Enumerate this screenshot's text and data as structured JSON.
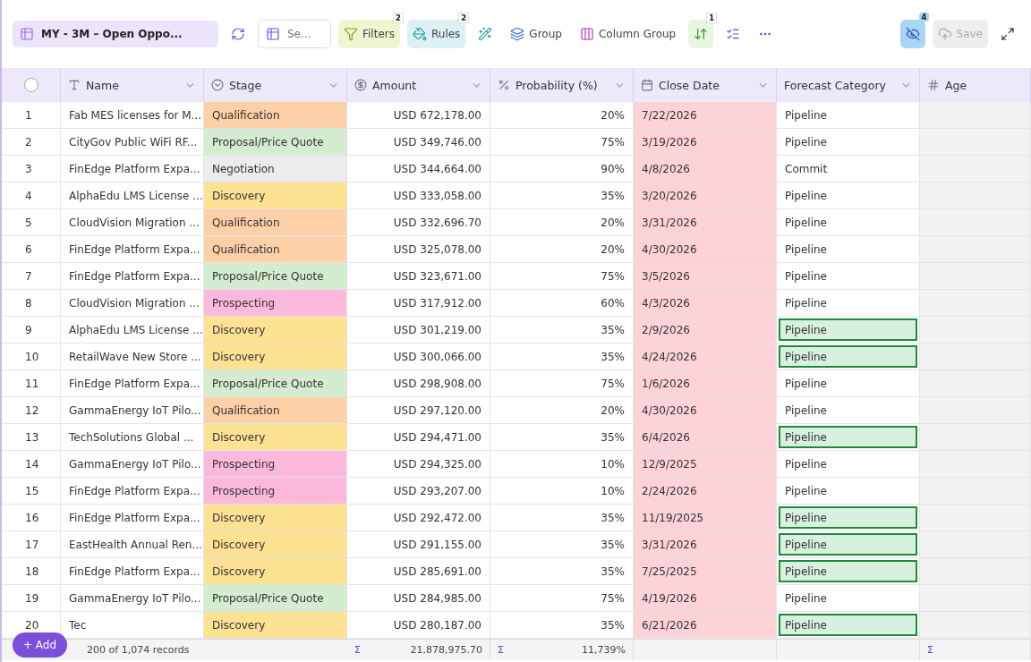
{
  "toolbar": {
    "view": "MY - 3M – Open Oppo...",
    "search": {
      "placeholder": "Se..."
    },
    "filters": {
      "label": "Filters",
      "badge": "2"
    },
    "rules": {
      "label": "Rules",
      "badge": "2"
    },
    "group": {
      "label": "Group"
    },
    "column_group": {
      "label": "Column Group"
    },
    "sort": {
      "badge": "1"
    },
    "hidden_fields": {
      "badge": "4"
    },
    "save": {
      "label": "Save",
      "disabled": true
    }
  },
  "table": {
    "select_all": {
      "checked": false
    },
    "columns": [
      {
        "label": "Name"
      },
      {
        "label": "Stage"
      },
      {
        "label": "Amount"
      },
      {
        "label": "Probability (%)"
      },
      {
        "label": "Close Date"
      },
      {
        "label": "Forecast Category"
      },
      {
        "label": "Age"
      }
    ],
    "rows": [
      {
        "n": "1",
        "name": "Fab MES licenses for M...",
        "stage": "Qualification",
        "color": "#fdd0a8",
        "amount": "USD 672,178.00",
        "prob": "20%",
        "date": "7/22/2026",
        "forecast": "Pipeline",
        "highlighted": false
      },
      {
        "n": "2",
        "name": "CityGov Public WiFi RF...",
        "stage": "Proposal/Price Quote",
        "color": "#d4ecd0",
        "amount": "USD 349,746.00",
        "prob": "75%",
        "date": "3/19/2026",
        "forecast": "Pipeline",
        "highlighted": false
      },
      {
        "n": "3",
        "name": "FinEdge Platform Expa...",
        "stage": "Negotiation",
        "color": "#ececee",
        "amount": "USD 344,664.00",
        "prob": "90%",
        "date": "4/8/2026",
        "forecast": "Commit",
        "highlighted": false
      },
      {
        "n": "4",
        "name": "AlphaEdu LMS License ...",
        "stage": "Discovery",
        "color": "#fde293",
        "amount": "USD 333,058.00",
        "prob": "35%",
        "date": "3/20/2026",
        "forecast": "Pipeline",
        "highlighted": false
      },
      {
        "n": "5",
        "name": "CloudVision Migration ...",
        "stage": "Qualification",
        "color": "#fdd0a8",
        "amount": "USD 332,696.70",
        "prob": "20%",
        "date": "3/31/2026",
        "forecast": "Pipeline",
        "highlighted": false
      },
      {
        "n": "6",
        "name": "FinEdge Platform Expa...",
        "stage": "Qualification",
        "color": "#fdd0a8",
        "amount": "USD 325,078.00",
        "prob": "20%",
        "date": "4/30/2026",
        "forecast": "Pipeline",
        "highlighted": false
      },
      {
        "n": "7",
        "name": "FinEdge Platform Expa...",
        "stage": "Proposal/Price Quote",
        "color": "#d4ecd0",
        "amount": "USD 323,671.00",
        "prob": "75%",
        "date": "3/5/2026",
        "forecast": "Pipeline",
        "highlighted": false
      },
      {
        "n": "8",
        "name": "CloudVision Migration ...",
        "stage": "Prospecting",
        "color": "#fcb9dc",
        "amount": "USD 317,912.00",
        "prob": "60%",
        "date": "4/3/2026",
        "forecast": "Pipeline",
        "highlighted": false
      },
      {
        "n": "9",
        "name": "AlphaEdu LMS License ...",
        "stage": "Discovery",
        "color": "#fde293",
        "amount": "USD 301,219.00",
        "prob": "35%",
        "date": "2/9/2026",
        "forecast": "Pipeline",
        "highlighted": true
      },
      {
        "n": "10",
        "name": "RetailWave New Store ...",
        "stage": "Discovery",
        "color": "#fde293",
        "amount": "USD 300,066.00",
        "prob": "35%",
        "date": "4/24/2026",
        "forecast": "Pipeline",
        "highlighted": true
      },
      {
        "n": "11",
        "name": "FinEdge Platform Expa...",
        "stage": "Proposal/Price Quote",
        "color": "#d4ecd0",
        "amount": "USD 298,908.00",
        "prob": "75%",
        "date": "1/6/2026",
        "forecast": "Pipeline",
        "highlighted": false
      },
      {
        "n": "12",
        "name": "GammaEnergy IoT Pilo...",
        "stage": "Qualification",
        "color": "#fdd0a8",
        "amount": "USD 297,120.00",
        "prob": "20%",
        "date": "4/30/2026",
        "forecast": "Pipeline",
        "highlighted": false
      },
      {
        "n": "13",
        "name": "TechSolutions Global ...",
        "stage": "Discovery",
        "color": "#fde293",
        "amount": "USD 294,471.00",
        "prob": "35%",
        "date": "6/4/2026",
        "forecast": "Pipeline",
        "highlighted": true
      },
      {
        "n": "14",
        "name": "GammaEnergy IoT Pilo...",
        "stage": "Prospecting",
        "color": "#fcb9dc",
        "amount": "USD 294,325.00",
        "prob": "10%",
        "date": "12/9/2025",
        "forecast": "Pipeline",
        "highlighted": false
      },
      {
        "n": "15",
        "name": "FinEdge Platform Expa...",
        "stage": "Prospecting",
        "color": "#fcb9dc",
        "amount": "USD 293,207.00",
        "prob": "10%",
        "date": "2/24/2026",
        "forecast": "Pipeline",
        "highlighted": false
      },
      {
        "n": "16",
        "name": "FinEdge Platform Expa...",
        "stage": "Discovery",
        "color": "#fde293",
        "amount": "USD 292,472.00",
        "prob": "35%",
        "date": "11/19/2025",
        "forecast": "Pipeline",
        "highlighted": true
      },
      {
        "n": "17",
        "name": "EastHealth Annual Ren...",
        "stage": "Discovery",
        "color": "#fde293",
        "amount": "USD 291,155.00",
        "prob": "35%",
        "date": "3/31/2026",
        "forecast": "Pipeline",
        "highlighted": true
      },
      {
        "n": "18",
        "name": "FinEdge Platform Expa...",
        "stage": "Discovery",
        "color": "#fde293",
        "amount": "USD 285,691.00",
        "prob": "35%",
        "date": "7/25/2025",
        "forecast": "Pipeline",
        "highlighted": true
      },
      {
        "n": "19",
        "name": "GammaEnergy IoT Pilo...",
        "stage": "Proposal/Price Quote",
        "color": "#d4ecd0",
        "amount": "USD 284,985.00",
        "prob": "75%",
        "date": "4/19/2026",
        "forecast": "Pipeline",
        "highlighted": false
      },
      {
        "n": "20",
        "name": "Tec",
        "stage": "Discovery",
        "color": "#fde293",
        "amount": "USD 280,187.00",
        "prob": "35%",
        "date": "6/21/2026",
        "forecast": "Pipeline",
        "highlighted": true
      }
    ]
  },
  "footer": {
    "add": "+ Add",
    "records": "200 of 1,074 records",
    "amount_sigma": "Σ",
    "amount_sum": "21,878,975.70",
    "prob_sigma": "Σ",
    "prob_sum": "11,739%",
    "age_sigma": "Σ"
  }
}
